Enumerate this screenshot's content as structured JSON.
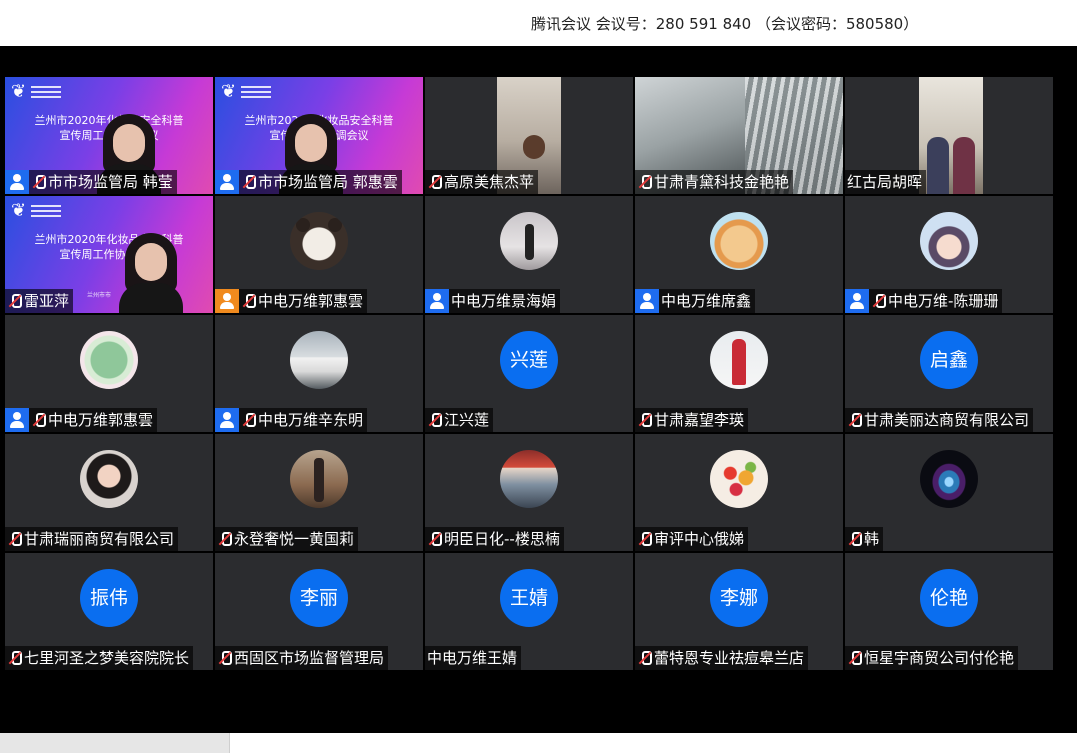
{
  "window": {
    "meeting_info": "腾讯会议 会议号：280 591 840 （会议密码：580580）"
  },
  "share_slide": {
    "title_line1": "兰州市2020年化妆品安全科普",
    "title_line2": "宣传周工作协调会议",
    "caption": "兰州市市"
  },
  "tiles": [
    {
      "type": "share",
      "name": "市市场监管局  韩莹",
      "icon": "blue",
      "mic": true
    },
    {
      "type": "share",
      "name": "市市场监管局 郭惠雲",
      "icon": "blue",
      "mic": true
    },
    {
      "type": "video",
      "name": "高原美焦杰苹",
      "icon": null,
      "mic": true,
      "scene": "scene-a"
    },
    {
      "type": "video",
      "name": "甘肃青黛科技金艳艳",
      "icon": null,
      "mic": true,
      "scene": "scene-b"
    },
    {
      "type": "video",
      "name": "红古局胡晖",
      "icon": null,
      "mic": false,
      "scene": "scene-c"
    },
    {
      "type": "share",
      "name": "雷亚萍",
      "icon": null,
      "mic": true
    },
    {
      "type": "photo",
      "name": "中电万维郭惠雲",
      "icon": "orange",
      "mic": true,
      "avatar": "av-bear"
    },
    {
      "type": "photo",
      "name": "中电万维景海娟",
      "icon": "blue",
      "mic": false,
      "avatar": "av-girl-walk"
    },
    {
      "type": "photo",
      "name": "中电万维席鑫",
      "icon": "blue",
      "mic": false,
      "avatar": "av-cat"
    },
    {
      "type": "photo",
      "name": "中电万维-陈珊珊",
      "icon": "blue",
      "mic": true,
      "avatar": "av-anime"
    },
    {
      "type": "photo",
      "name": "中电万维郭惠雲",
      "icon": "blue",
      "mic": true,
      "avatar": "av-leaf"
    },
    {
      "type": "photo",
      "name": "中电万维辛东明",
      "icon": "blue",
      "mic": true,
      "avatar": "av-car"
    },
    {
      "type": "badge",
      "name": "江兴莲",
      "icon": null,
      "mic": true,
      "badge": "兴莲"
    },
    {
      "type": "photo",
      "name": "甘肃嘉望李瑛",
      "icon": null,
      "mic": true,
      "avatar": "av-red"
    },
    {
      "type": "badge",
      "name": "甘肃美丽达商贸有限公司",
      "icon": null,
      "mic": true,
      "badge": "启鑫"
    },
    {
      "type": "photo",
      "name": "甘肃瑞丽商贸有限公司",
      "icon": null,
      "mic": true,
      "avatar": "av-woman"
    },
    {
      "type": "photo",
      "name": "永登奢悦一黄国莉",
      "icon": null,
      "mic": true,
      "avatar": "av-walker"
    },
    {
      "type": "photo",
      "name": "明臣日化--楼思楠",
      "icon": null,
      "mic": true,
      "avatar": "av-shop"
    },
    {
      "type": "photo",
      "name": "审评中心俄娣",
      "icon": null,
      "mic": true,
      "avatar": "av-fruit"
    },
    {
      "type": "photo",
      "name": "韩",
      "icon": null,
      "mic": true,
      "avatar": "av-space"
    },
    {
      "type": "badge",
      "name": "七里河圣之梦美容院院长",
      "icon": null,
      "mic": true,
      "badge": "振伟"
    },
    {
      "type": "badge",
      "name": "西固区市场监督管理局",
      "icon": null,
      "mic": true,
      "badge": "李丽"
    },
    {
      "type": "badge",
      "name": "中电万维王婧",
      "icon": null,
      "mic": false,
      "badge": "王婧"
    },
    {
      "type": "badge",
      "name": "蕾特恩专业祛痘皋兰店",
      "icon": null,
      "mic": true,
      "badge": "李娜"
    },
    {
      "type": "badge",
      "name": "恒星宇商贸公司付伦艳",
      "icon": null,
      "mic": true,
      "badge": "伦艳"
    }
  ]
}
